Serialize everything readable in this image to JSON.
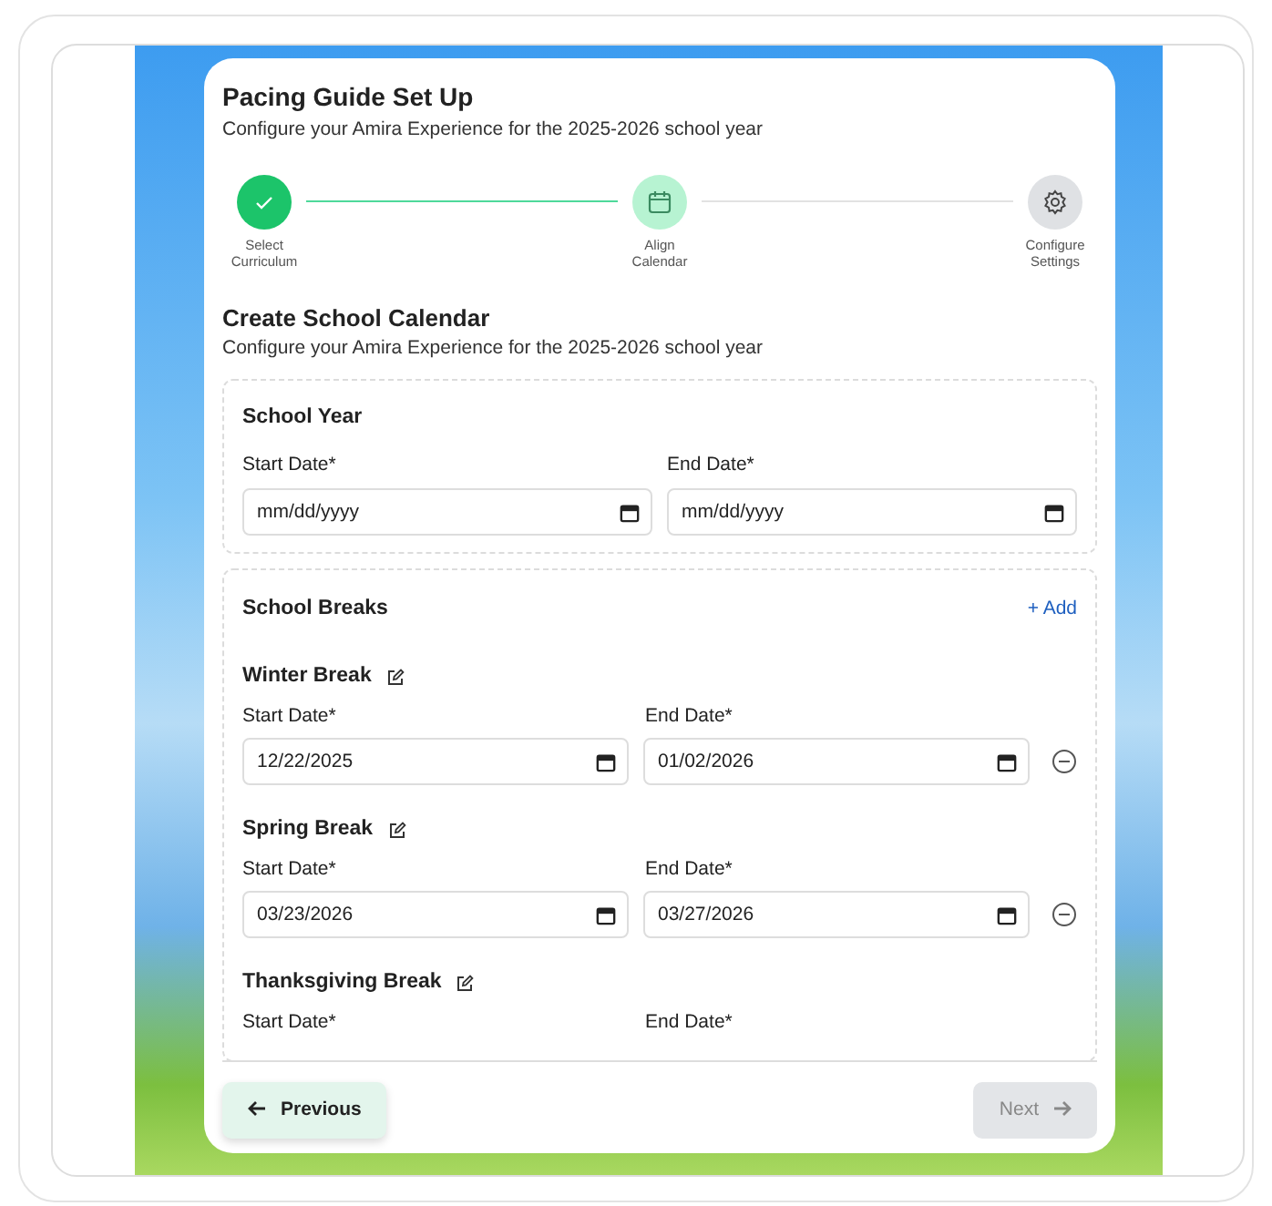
{
  "header": {
    "title": "Pacing Guide Set Up",
    "subtitle": "Configure your Amira Experience for the 2025-2026 school year"
  },
  "steps": [
    {
      "label": "Select Curriculum",
      "completed": true,
      "selected": false
    },
    {
      "label": "Align Calendar",
      "completed": false,
      "selected": true
    },
    {
      "label": "Configure Settings",
      "completed": false,
      "selected": false
    }
  ],
  "section": {
    "title": "Create School Calendar",
    "subtitle": "Configure your Amira Experience for the 2025-2026 school year"
  },
  "school_year": {
    "title": "School Year",
    "start_label": "Start Date*",
    "end_label": "End Date*",
    "start_placeholder": "mm/dd/yyyy",
    "end_placeholder": "mm/dd/yyyy"
  },
  "school_breaks": {
    "title": "School Breaks",
    "add_label": "+ Add",
    "items": [
      {
        "name": "Winter Break",
        "start_label": "Start Date*",
        "end_label": "End Date*",
        "start": "12/22/2025",
        "end": "01/02/2026"
      },
      {
        "name": "Spring Break",
        "start_label": "Start Date*",
        "end_label": "End Date*",
        "start": "03/23/2026",
        "end": "03/27/2026"
      },
      {
        "name": "Thanksgiving Break",
        "start_label": "Start Date*",
        "end_label": "End Date*"
      }
    ]
  },
  "footer": {
    "previous": {
      "label": "Previous"
    },
    "next": {
      "label": "Next",
      "disabled": true
    }
  }
}
